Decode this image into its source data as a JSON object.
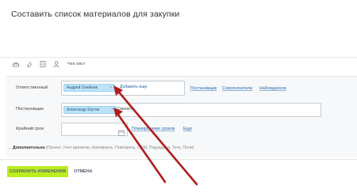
{
  "title": "Составить список материалов для закупки",
  "toolbar": {
    "icons": [
      "eye-icon",
      "attach-icon",
      "document-icon",
      "user-icon"
    ],
    "checklist_label": "Чек лист"
  },
  "form": {
    "responsible": {
      "label": "Ответственный",
      "chip": "Андрей Олейник",
      "chip_close": "×",
      "add_more": "Добавить еще",
      "links": [
        "Постановщик",
        "Соисполнители",
        "Наблюдатели"
      ]
    },
    "creator": {
      "label": "Постановщик",
      "chip": "Александр Шутов",
      "chip_close": "×",
      "change": "Сменить"
    },
    "deadline": {
      "label": "Крайний срок",
      "planning": "Планирование сроков",
      "more": "Еще"
    },
    "more": {
      "label": "Дополнительно",
      "items": "(Проект, Учет времени, Напомнить, Повторять, CRM, Подзадача, Теги, Поля)"
    }
  },
  "footer": {
    "save": "СОХРАНИТЬ ИЗМЕНЕНИЯ",
    "cancel": "ОТМЕНА"
  },
  "colors": {
    "chip_bg": "#bce3f7",
    "link": "#2067b0",
    "save_bg": "#bbed21",
    "arrow": "#b01e1e"
  }
}
